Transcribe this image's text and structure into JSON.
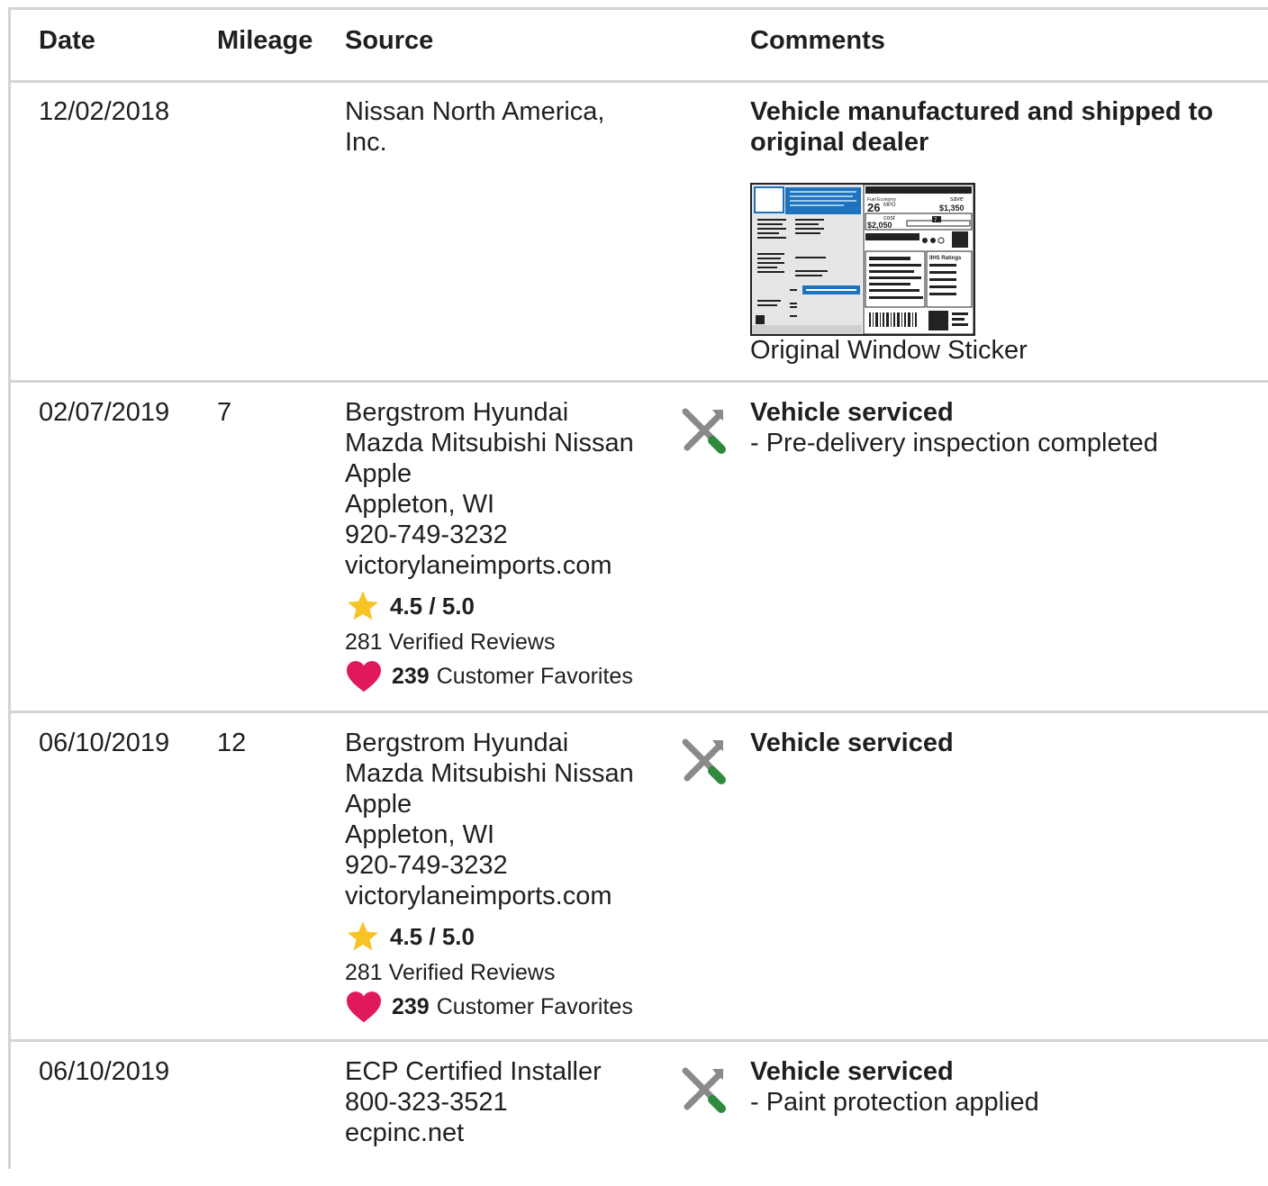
{
  "headers": {
    "date": "Date",
    "mileage": "Mileage",
    "source": "Source",
    "comments": "Comments"
  },
  "records": [
    {
      "date": "12/02/2018",
      "mileage": "",
      "source_lines": [
        "Nissan North America,",
        "Inc."
      ],
      "comment_title_lines": [
        "Vehicle manufactured and shipped to",
        "original dealer"
      ],
      "sticker_caption": "Original Window Sticker",
      "sticker": {
        "mpg": "26",
        "mpg_unit": "MPG",
        "you_save": "save",
        "save_amount": "$1,350",
        "annual_cost_label": "cost",
        "annual_cost": "$2,050",
        "mid_value": "7",
        "ratings_label": "IIHS Ratings"
      }
    },
    {
      "date": "02/07/2019",
      "mileage": "7",
      "source_lines": [
        "Bergstrom Hyundai",
        "Mazda Mitsubishi Nissan",
        "Apple",
        "Appleton, WI",
        "920-749-3232",
        "victorylaneimports.com"
      ],
      "rating": "4.5 / 5.0",
      "reviews": "281 Verified Reviews",
      "favorites_count": "239",
      "favorites_label": "Customer Favorites",
      "comment_title_lines": [
        "Vehicle serviced"
      ],
      "comment_detail": "- Pre-delivery inspection completed"
    },
    {
      "date": "06/10/2019",
      "mileage": "12",
      "source_lines": [
        "Bergstrom Hyundai",
        "Mazda Mitsubishi Nissan",
        "Apple",
        "Appleton, WI",
        "920-749-3232",
        "victorylaneimports.com"
      ],
      "rating": "4.5 / 5.0",
      "reviews": "281 Verified Reviews",
      "favorites_count": "239",
      "favorites_label": "Customer Favorites",
      "comment_title_lines": [
        "Vehicle serviced"
      ],
      "comment_detail": ""
    },
    {
      "date": "06/10/2019",
      "mileage": "",
      "source_lines": [
        "ECP Certified Installer",
        "800-323-3521",
        "ecpinc.net"
      ],
      "comment_title_lines": [
        "Vehicle serviced"
      ],
      "comment_detail": "- Paint protection applied"
    }
  ],
  "colors": {
    "border": "#d4d4d4",
    "star": "#f7c325",
    "heart": "#e0195f",
    "wrench_green": "#2e8b3d",
    "tool_gray": "#8a8a8a",
    "sticker_blue": "#1e73be"
  },
  "icons": {
    "service": "tools-icon",
    "rating": "star-icon",
    "favorites": "heart-icon"
  }
}
